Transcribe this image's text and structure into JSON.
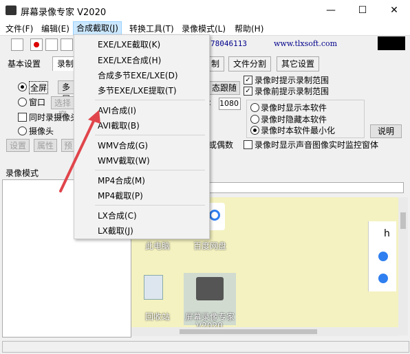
{
  "window": {
    "title": "屏幕录像专家 V2020",
    "minimize": "—",
    "maximize": "☐",
    "close": "✕"
  },
  "menubar": [
    "文件(F)",
    "编辑(E)",
    "合成截取(J)",
    "转换工具(T)",
    "录像模式(L)",
    "帮助(H)"
  ],
  "toolbar": {
    "phone": "78046113",
    "url": "www.tlxsoft.com"
  },
  "tabs": [
    "基本设置",
    "录制",
    "制",
    "文件分割",
    "其它设置"
  ],
  "basic": {
    "fullscreen": "全屏",
    "multi": "多屏",
    "window": "窗口",
    "select": "选择窗",
    "camera_sync": "同时录摄像头",
    "camera": "摄像头",
    "btn_settings": "设置",
    "btn_props": "属性",
    "btn_pre": "预",
    "dyn": "态跟随",
    "num": "1080",
    "odd": "或偶数"
  },
  "options": {
    "hint_range": "录像时提示录制范围",
    "hint_before": "录像前提示录制范围",
    "show_self": "录像时显示本软件",
    "hide_self": "录像时隐藏本软件",
    "min_self": "录像时本软件最小化",
    "explain": "说明",
    "audio_monitor": "录像时显示声音图像实时监控窗体"
  },
  "left_label": "录像模式",
  "desktop": {
    "this_pc": "此电脑",
    "baidu": "百度网盘",
    "recycle": "回收站",
    "recorder": "屏幕录像专家",
    "recorder2": "V2020",
    "strip_h": "h"
  },
  "menu": [
    "EXE/LXE截取(K)",
    "EXE/LXE合成(H)",
    "合成多节EXE/LXE(D)",
    "多节EXE/LXE提取(T)",
    "AVI合成(I)",
    "AVI截取(B)",
    "WMV合成(G)",
    "WMV截取(W)",
    "MP4合成(M)",
    "MP4截取(P)",
    "LX合成(C)",
    "LX截取(J)"
  ]
}
